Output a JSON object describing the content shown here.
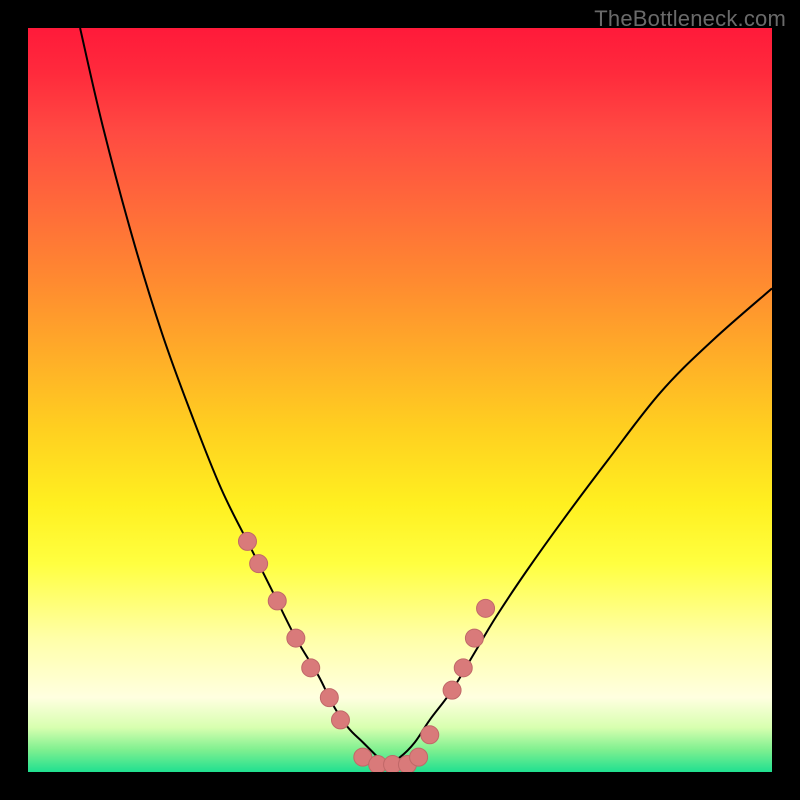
{
  "watermark": "TheBottleneck.com",
  "colors": {
    "frame": "#000000",
    "curve": "#000000",
    "marker_fill": "#d97a7a",
    "marker_stroke": "#c06868",
    "gradient_stops": [
      "#ff1a3a",
      "#ff2a3c",
      "#ff4a42",
      "#ff6a3a",
      "#ff8a30",
      "#ffad28",
      "#ffd020",
      "#fff020",
      "#ffff40",
      "#ffffa8",
      "#ffffe0",
      "#d8ffb0",
      "#80f090",
      "#20e090"
    ]
  },
  "chart_data": {
    "type": "line",
    "title": "",
    "xlabel": "",
    "ylabel": "",
    "xlim": [
      0,
      100
    ],
    "ylim": [
      0,
      100
    ],
    "grid": false,
    "legend": false,
    "series": [
      {
        "name": "bottleneck-curve-left",
        "x": [
          7,
          10,
          14,
          18,
          22,
          26,
          30,
          33,
          36,
          39,
          41,
          43,
          45,
          47,
          48
        ],
        "values": [
          100,
          87,
          72,
          59,
          48,
          38,
          30,
          24,
          18,
          13,
          9,
          6,
          4,
          2,
          1
        ]
      },
      {
        "name": "bottleneck-curve-right",
        "x": [
          48,
          50,
          52,
          54,
          57,
          60,
          63,
          67,
          72,
          78,
          85,
          92,
          100
        ],
        "values": [
          1,
          2,
          4,
          7,
          11,
          16,
          21,
          27,
          34,
          42,
          51,
          58,
          65
        ]
      }
    ],
    "markers": {
      "name": "highlight-points",
      "x": [
        29.5,
        31,
        33.5,
        36,
        38,
        40.5,
        42,
        45,
        47,
        49,
        51,
        52.5,
        54,
        57,
        58.5,
        60,
        61.5
      ],
      "values": [
        31,
        28,
        23,
        18,
        14,
        10,
        7,
        2,
        1,
        1,
        1,
        2,
        5,
        11,
        14,
        18,
        22
      ]
    }
  }
}
